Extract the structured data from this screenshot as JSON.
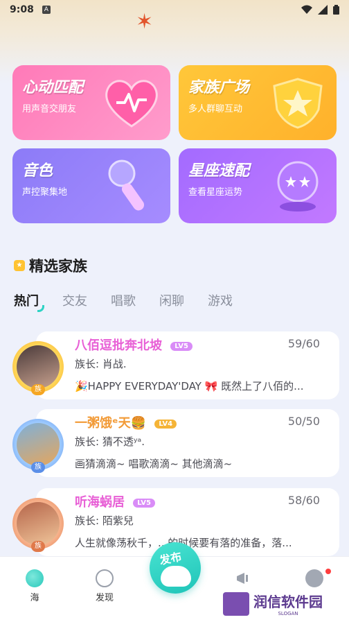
{
  "status_bar": {
    "time": "9:08",
    "indicator": "A"
  },
  "feature_cards": [
    {
      "title": "心动匹配",
      "subtitle": "用声音交朋友",
      "icon": "heart-pulse-icon"
    },
    {
      "title": "家族广场",
      "subtitle": "多人群聊互动",
      "icon": "star-shield-icon"
    },
    {
      "title": "音色",
      "subtitle": "声控聚集地",
      "icon": "microphone-icon"
    },
    {
      "title": "星座速配",
      "subtitle": "查看星座运势",
      "icon": "crystal-ball-icon"
    }
  ],
  "section": {
    "title": "精选家族"
  },
  "tabs": [
    {
      "label": "热门",
      "active": true
    },
    {
      "label": "交友",
      "active": false
    },
    {
      "label": "唱歌",
      "active": false
    },
    {
      "label": "闲聊",
      "active": false
    },
    {
      "label": "游戏",
      "active": false
    }
  ],
  "families": [
    {
      "name": "八佰逗批奔北坡",
      "name_color": "#e860d6",
      "level": "LV5",
      "level_color": "#d98cf7",
      "count": "59/60",
      "leader": "族长: 肖战.",
      "desc": "🎉HAPPY EVERYDAY'DAY 🎀  既然上了八佰的...",
      "badge": "族"
    },
    {
      "name": "一粥饿ᵉ天🍔",
      "name_color": "#f29a36",
      "level": "LV4",
      "level_color": "#f5b437",
      "count": "50/50",
      "leader": "族长: 猜不透ʸᵃ.",
      "desc": "画猜滴滴~ 唱歌滴滴~ 其他滴滴~",
      "badge": "族"
    },
    {
      "name": "听海蜗居",
      "name_color": "#e860d6",
      "level": "LV5",
      "level_color": "#d98cf7",
      "count": "58/60",
      "leader": "族长: 陌紫兒",
      "desc": "人生就像荡秋千，...的时候要有落的准备，落...",
      "badge": "族"
    }
  ],
  "nav": {
    "home": "海",
    "discover": "发现",
    "publish": "发布"
  },
  "watermark": {
    "text": "润信软件园",
    "slogan": "SLOGAN"
  }
}
